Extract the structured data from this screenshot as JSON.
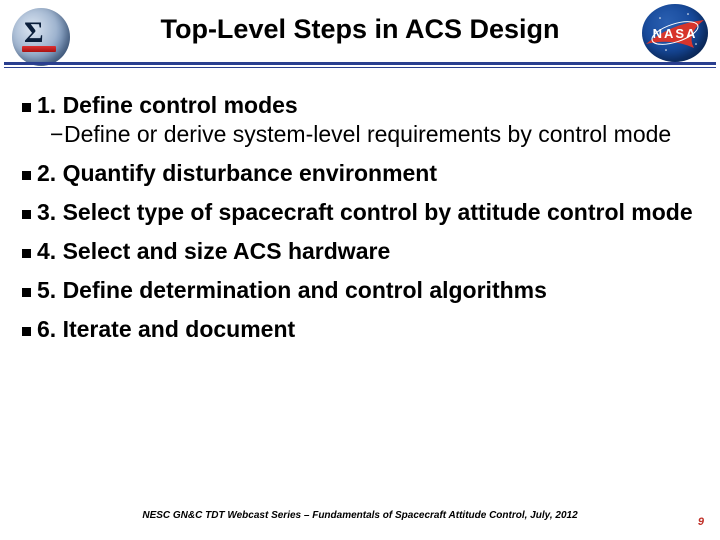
{
  "header": {
    "title": "Top-Level Steps in ACS Design",
    "left_logo": {
      "name": "nesc-sigma-logo"
    },
    "right_logo": {
      "name": "nasa-meatball-logo",
      "text": "NASA"
    }
  },
  "steps": [
    {
      "label": "1. Define control modes",
      "subs": [
        "Define or derive system-level requirements by control mode"
      ]
    },
    {
      "label": "2. Quantify disturbance environment",
      "subs": []
    },
    {
      "label": "3. Select type of spacecraft control by attitude control mode",
      "subs": []
    },
    {
      "label": "4. Select and size ACS hardware",
      "subs": []
    },
    {
      "label": "5. Define determination and control algorithms",
      "subs": []
    },
    {
      "label": "6. Iterate and document",
      "subs": []
    }
  ],
  "footer": {
    "text": "NESC GN&C TDT Webcast Series – Fundamentals of Spacecraft Attitude Control, July, 2012",
    "page": "9"
  }
}
